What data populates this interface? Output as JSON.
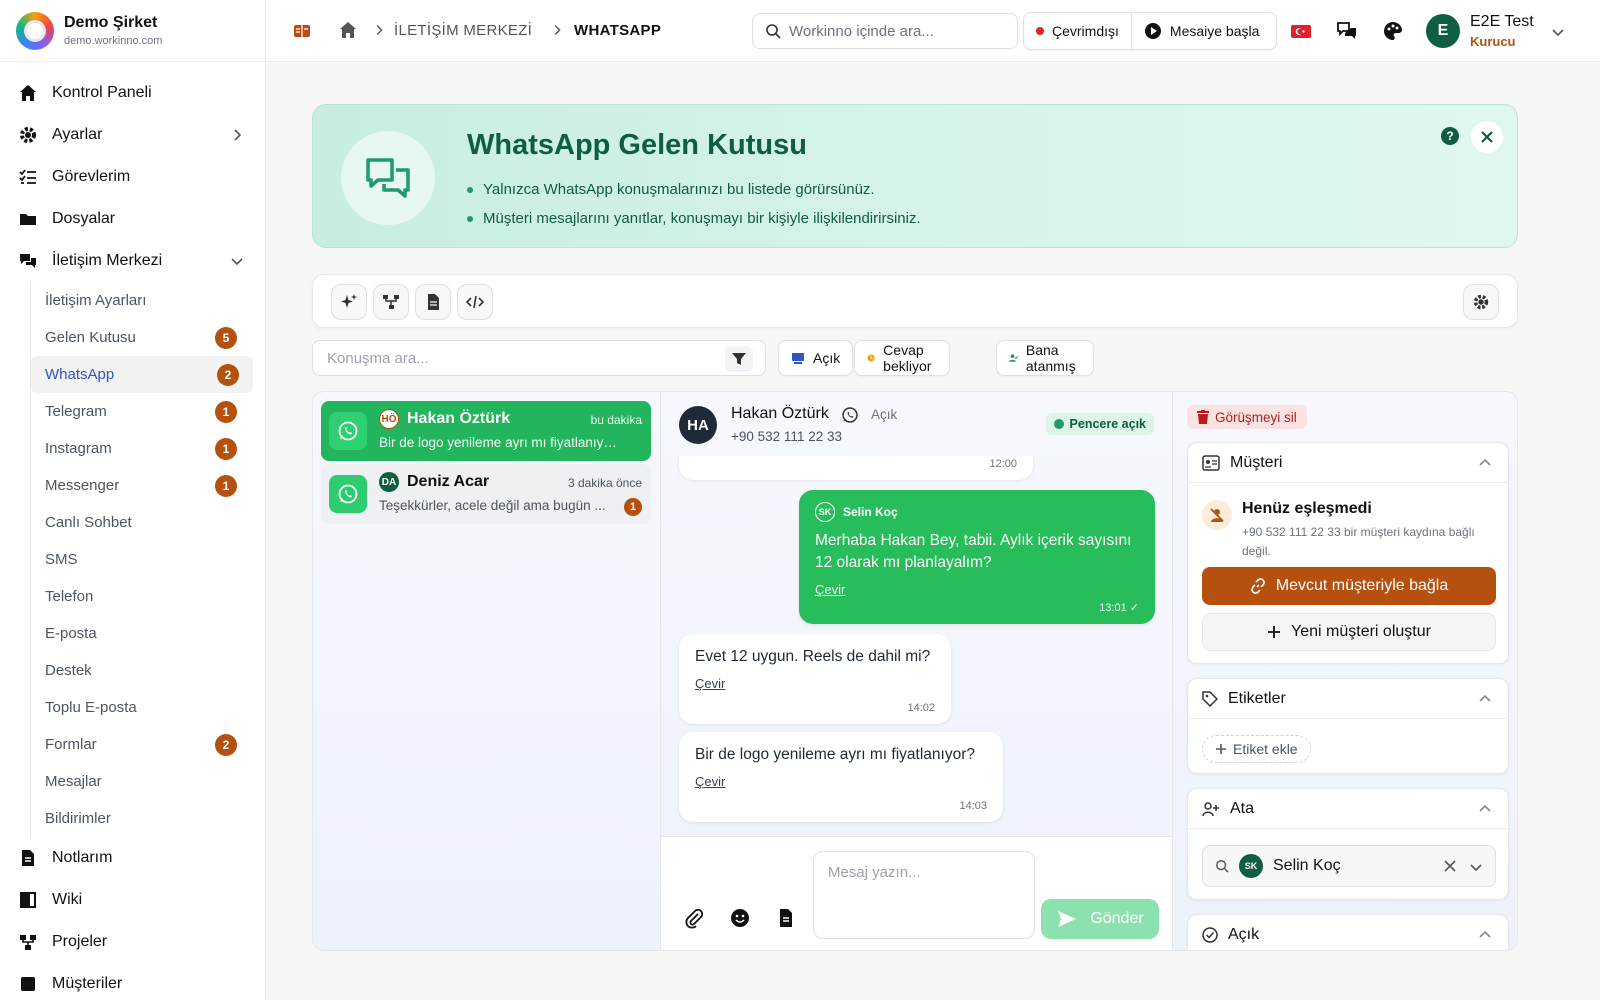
{
  "brand": {
    "name": "Demo Şirket",
    "url": "demo.workinno.com"
  },
  "sidebar": {
    "items": [
      {
        "label": "Kontrol Paneli",
        "icon": "home-icon"
      },
      {
        "label": "Ayarlar",
        "icon": "gear-icon"
      },
      {
        "label": "Görevlerim",
        "icon": "task-list-icon"
      },
      {
        "label": "Dosyalar",
        "icon": "folder-icon"
      },
      {
        "label": "İletişim Merkezi",
        "icon": "chat-bubbles-icon"
      }
    ],
    "sub_items": [
      {
        "label": "İletişim Ayarları",
        "badge": ""
      },
      {
        "label": "Gelen Kutusu",
        "badge": "5"
      },
      {
        "label": "WhatsApp",
        "badge": "2"
      },
      {
        "label": "Telegram",
        "badge": "1"
      },
      {
        "label": "Instagram",
        "badge": "1"
      },
      {
        "label": "Messenger",
        "badge": "1"
      },
      {
        "label": "Canlı Sohbet",
        "badge": ""
      },
      {
        "label": "SMS",
        "badge": ""
      },
      {
        "label": "Telefon",
        "badge": ""
      },
      {
        "label": "E-posta",
        "badge": ""
      },
      {
        "label": "Destek",
        "badge": ""
      },
      {
        "label": "Toplu E-posta",
        "badge": ""
      },
      {
        "label": "Formlar",
        "badge": "2"
      },
      {
        "label": "Mesajlar",
        "badge": ""
      },
      {
        "label": "Bildirimler",
        "badge": ""
      }
    ],
    "bottom_items": [
      {
        "label": "Notlarım",
        "icon": "note-icon"
      },
      {
        "label": "Wiki",
        "icon": "book-icon"
      },
      {
        "label": "Projeler",
        "icon": "project-icon"
      },
      {
        "label": "Müşteriler",
        "icon": "customers-icon"
      }
    ]
  },
  "topbar": {
    "breadcrumb": [
      "İLETİŞİM MERKEZİ",
      "WHATSAPP"
    ],
    "search_placeholder": "Workinno içinde ara...",
    "status": "Çevrimdışı",
    "start_label": "Mesaiye başla",
    "user": {
      "initial": "E",
      "name": "E2E Test",
      "role": "Kurucu"
    }
  },
  "hero": {
    "title": "WhatsApp Gelen Kutusu",
    "bullets": [
      "Yalnızca WhatsApp konuşmalarınızı bu listede görürsünüz.",
      "Müşteri mesajlarını yanıtlar, konuşmayı bir kişiyle ilişkilendirirsiniz."
    ],
    "help": "?"
  },
  "filters": {
    "search_placeholder": "Konuşma ara...",
    "chips": [
      "Açık",
      "Cevap bekliyor",
      "Bana atanmış"
    ]
  },
  "conversations": [
    {
      "initials": "HÖ",
      "name": "Hakan Öztürk",
      "time": "bu dakika",
      "preview": "Bir de logo yenileme ayrı mı fiyatlanıyor?",
      "badge": ""
    },
    {
      "initials": "DA",
      "name": "Deniz Acar",
      "time": "3 dakika önce",
      "preview": "Teşekkürler, acele değil ama bugün ...",
      "badge": "1"
    }
  ],
  "chat": {
    "avatar": "HA",
    "name": "Hakan Öztürk",
    "status": "Açık",
    "phone": "+90 532 111 22 33",
    "window": "Pencere açık",
    "prev_time": "12:00",
    "messages": [
      {
        "sender_initials": "SK",
        "sender": "Selin Koç",
        "text": "Merhaba Hakan Bey, tabii. Aylık içerik sayısını 12 olarak mı planlayalım?",
        "translate": "Çevir",
        "time": "13:01"
      },
      {
        "text": "Evet 12 uygun. Reels de dahil mi?",
        "translate": "Çevir",
        "time": "14:02"
      },
      {
        "text": "Bir de logo yenileme ayrı mı fiyatlanıyor?",
        "translate": "Çevir",
        "time": "14:03"
      }
    ],
    "input_placeholder": "Mesaj yazın...",
    "send_label": "Gönder"
  },
  "side": {
    "delete_label": "Görüşmeyi sil",
    "customer": {
      "title": "Müşteri",
      "unmatched_title": "Henüz eşleşmedi",
      "unmatched_desc": "+90 532 111 22 33 bir müşteri kaydına bağlı değil.",
      "link_label": "Mevcut müşteriyle bağla",
      "create_label": "Yeni müşteri oluştur"
    },
    "tags": {
      "title": "Etiketler",
      "add_label": "Etiket ekle"
    },
    "assign": {
      "title": "Ata",
      "initials": "SK",
      "assignee": "Selin Koç"
    },
    "status_card": {
      "title": "Açık"
    }
  },
  "colors": {
    "accent": "#b5500e",
    "whatsapp": "#22b55e",
    "brand_green": "#0f5e3f"
  }
}
